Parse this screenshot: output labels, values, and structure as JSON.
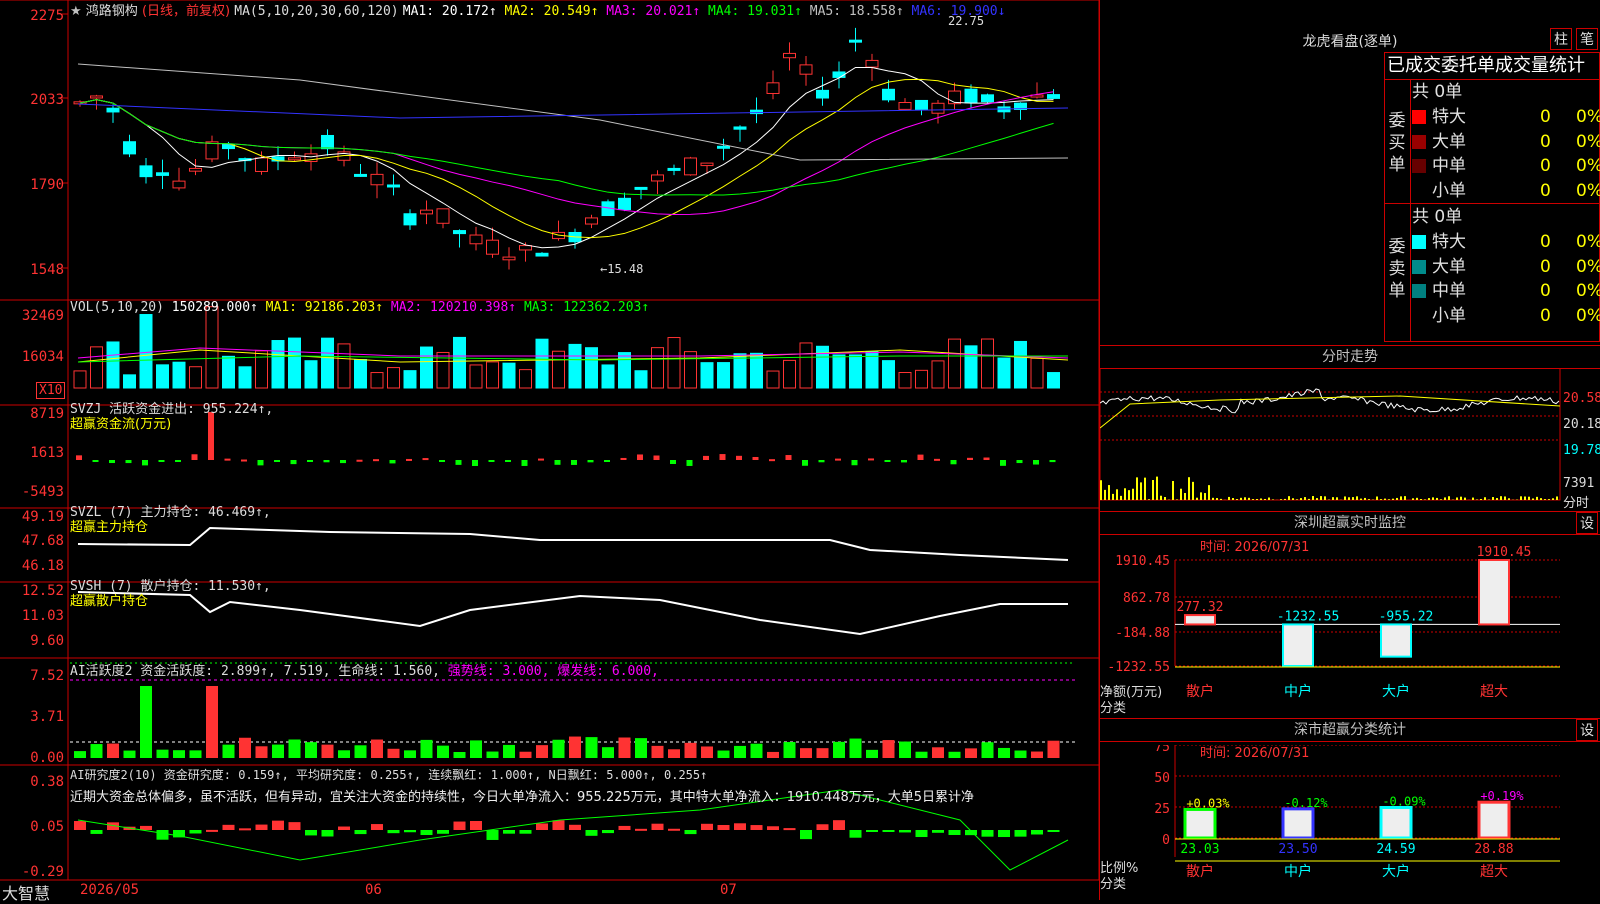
{
  "stock": {
    "star": "★",
    "name": "鸿路钢构",
    "mode": "(日线，前复权)",
    "ma_label": "MA(5,10,20,30,60,120)",
    "ma": [
      {
        "label": "MA1: 20.172↑",
        "color": "#ffffff"
      },
      {
        "label": "MA2: 20.549↑",
        "color": "#ffff00"
      },
      {
        "label": "MA3: 20.021↑",
        "color": "#ff00ff"
      },
      {
        "label": "MA4: 19.031↑",
        "color": "#00ff00"
      },
      {
        "label": "MA5: 18.558↑",
        "color": "#c0c0c0"
      },
      {
        "label": "MA6: 19.900↓",
        "color": "#3333ff"
      }
    ],
    "price_axis": [
      "2275",
      "2033",
      "1790",
      "1548"
    ],
    "high_label": "22.75",
    "low_label": "←15.48"
  },
  "vol": {
    "title": "VOL(5,10,20)",
    "items": [
      {
        "label": "150289.000↑",
        "color": "#ffffff"
      },
      {
        "label": "MA1: 92186.203↑",
        "color": "#ffff00"
      },
      {
        "label": "MA2: 120210.398↑",
        "color": "#ff00ff"
      },
      {
        "label": "MA3: 122362.203↑",
        "color": "#00ff00"
      }
    ],
    "axis": [
      "32469",
      "16034"
    ],
    "unit": "X10"
  },
  "svzj": {
    "title": "SVZJ  活跃资金进出: 955.224↑,",
    "sub": "超赢资金流(万元)",
    "axis": [
      "8719",
      "1613",
      "-5493"
    ]
  },
  "svzl": {
    "title": "SVZL (7) 主力持仓: 46.469↑,",
    "sub": "超赢主力持仓",
    "axis": [
      "49.19",
      "47.68",
      "46.18"
    ]
  },
  "svsh": {
    "title": "SVSH (7) 散户持仓: 11.530↑,",
    "sub": "超赢散户持仓",
    "axis": [
      "12.52",
      "11.03",
      "9.60"
    ]
  },
  "ai1": {
    "t1": "AI活跃度2 资金活跃度: 2.899↑, 7.519, 生命线: 1.560,",
    "t2": " 强势线: 3.000, 爆发线: 6.000,",
    "axis": [
      "7.52",
      "3.71",
      "0.00"
    ]
  },
  "ai2": {
    "t1": "AI研究度2(10) 资金研究度: 0.159↑, 平均研究度: 0.255↑, 连续飘红: 1.000↑, N日飘红: 5.000↑, 0.255↑",
    "desc": "近期大资金总体偏多，虽不活跃，但有异动，宜关注大资金的持续性，今日大单净流入：955.225万元，其中特大单净流入：1910.448万元，大单5日累计净",
    "axis": [
      "0.38",
      "0.05",
      "-0.29"
    ]
  },
  "bottom": {
    "brand": "大智慧",
    "dates": [
      "2026/05",
      "06",
      "07"
    ]
  },
  "lhb": {
    "title": "龙虎看盘(逐单)",
    "btn1": "柱",
    "btn2": "笔",
    "tabs": "已成交委托单成交量统计",
    "buy_label": "委买单",
    "sell_label": "委卖单",
    "buy_total": "共 0单",
    "sell_total": "共 0单",
    "buy_rows": [
      {
        "name": "特大",
        "val": "0",
        "pct": "0%",
        "color": "#ff0000"
      },
      {
        "name": "大单",
        "val": "0",
        "pct": "0%",
        "color": "#990000"
      },
      {
        "name": "中单",
        "val": "0",
        "pct": "0%",
        "color": "#660000"
      },
      {
        "name": "小单",
        "val": "0",
        "pct": "0%",
        "color": ""
      }
    ],
    "sell_rows": [
      {
        "name": "特大",
        "val": "0",
        "pct": "0%",
        "color": "#00ffff"
      },
      {
        "name": "大单",
        "val": "0",
        "pct": "0%",
        "color": "#008b8b"
      },
      {
        "name": "中单",
        "val": "0",
        "pct": "0%",
        "color": "#008080"
      },
      {
        "name": "小单",
        "val": "0",
        "pct": "0%",
        "color": ""
      }
    ]
  },
  "fenshi": {
    "title": "分时走势",
    "axis": [
      "20.58",
      "20.18",
      "19.78"
    ],
    "vol": "7391",
    "unit": "分时"
  },
  "shenzhen_monitor": {
    "title": "深圳超赢实时监控",
    "btn": "设",
    "time": "时间: 2026/07/31",
    "axis": [
      "1910.45",
      "862.78",
      "-184.88",
      "-1232.55"
    ],
    "ylabel1": "净额(万元)",
    "ylabel2": "分类",
    "bars": [
      {
        "cat": "散户",
        "value": 277.32,
        "label": "277.32"
      },
      {
        "cat": "中户",
        "value": -1232.55,
        "label": "-1232.55"
      },
      {
        "cat": "大户",
        "value": -955.22,
        "label": "-955.22"
      },
      {
        "cat": "超大",
        "value": 1910.45,
        "label": "1910.45"
      }
    ]
  },
  "shenzhen_class": {
    "title": "深市超赢分类统计",
    "btn": "设",
    "time": "时间: 2026/07/31",
    "axis": [
      "75",
      "50",
      "25",
      "0"
    ],
    "ylabel1": "比例%",
    "ylabel2": "分类",
    "bars": [
      {
        "cat": "散户",
        "value": 23.03,
        "label": "23.03",
        "delta": "+0.03%",
        "color": "#00ff00",
        "dcolor": "#ffff00"
      },
      {
        "cat": "中户",
        "value": 23.5,
        "label": "23.50",
        "delta": "-0.12%",
        "color": "#3333ff",
        "dcolor": "#00ff00"
      },
      {
        "cat": "大户",
        "value": 24.59,
        "label": "24.59",
        "delta": "-0.09%",
        "color": "#00ffff",
        "dcolor": "#00ff00"
      },
      {
        "cat": "超大",
        "value": 28.88,
        "label": "28.88",
        "delta": "+0.19%",
        "color": "#ff3333",
        "dcolor": "#ff00ff"
      }
    ]
  }
}
